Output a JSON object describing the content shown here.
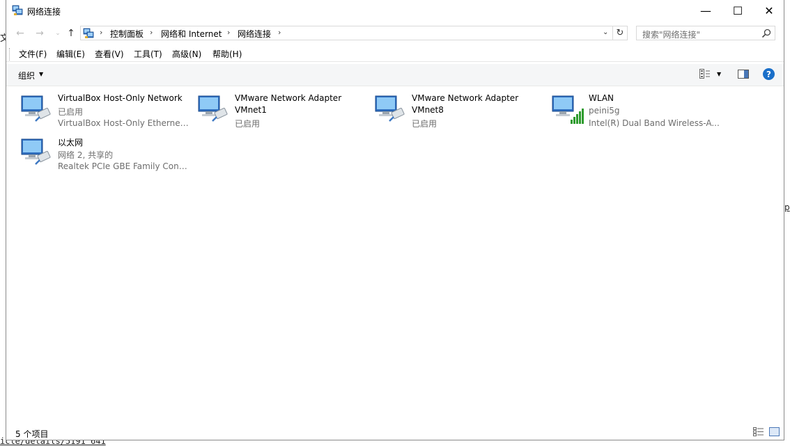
{
  "background": {
    "left_char": "文",
    "right_char": "p",
    "bottom_link": "icle/details/5191 641"
  },
  "window": {
    "title": "网络连接",
    "controls": {
      "minimize": "—",
      "maximize": "☐",
      "close": "✕"
    }
  },
  "navigation": {
    "back": "←",
    "forward": "→",
    "recent": "⌄",
    "up": "↑",
    "breadcrumb": [
      "控制面板",
      "网络和 Internet",
      "网络连接"
    ],
    "separator": "›",
    "dropdown": "⌄",
    "refresh": "↻",
    "search_placeholder": "搜索\"网络连接\""
  },
  "menu": {
    "items": [
      "文件(F)",
      "编辑(E)",
      "查看(V)",
      "工具(T)",
      "高级(N)",
      "帮助(H)"
    ]
  },
  "toolbar": {
    "organize": "组织",
    "dropdown_arrow": "▼",
    "help": "?"
  },
  "connections": [
    {
      "name": "VirtualBox Host-Only Network",
      "name_line2": "",
      "status": "已启用",
      "device": "VirtualBox Host-Only Ethernet ...",
      "icon": "network-adapter-icon"
    },
    {
      "name": "VMware Network Adapter",
      "name_line2": "VMnet1",
      "status": "已启用",
      "device": "",
      "icon": "network-adapter-icon"
    },
    {
      "name": "VMware Network Adapter",
      "name_line2": "VMnet8",
      "status": "已启用",
      "device": "",
      "icon": "network-adapter-icon"
    },
    {
      "name": "WLAN",
      "name_line2": "",
      "status": "peini5g",
      "device": "Intel(R) Dual Band Wireless-A...",
      "icon": "wireless-adapter-icon"
    },
    {
      "name": "以太网",
      "name_line2": "",
      "status": "网络  2, 共享的",
      "device": "Realtek PCIe GBE Family Contr...",
      "icon": "network-adapter-icon"
    }
  ],
  "status": {
    "item_count": "5 个项目"
  },
  "colors": {
    "accent": "#1a6fc9",
    "secondary_text": "#6d6d6d",
    "toolbar_bg": "#f5f6f7"
  }
}
